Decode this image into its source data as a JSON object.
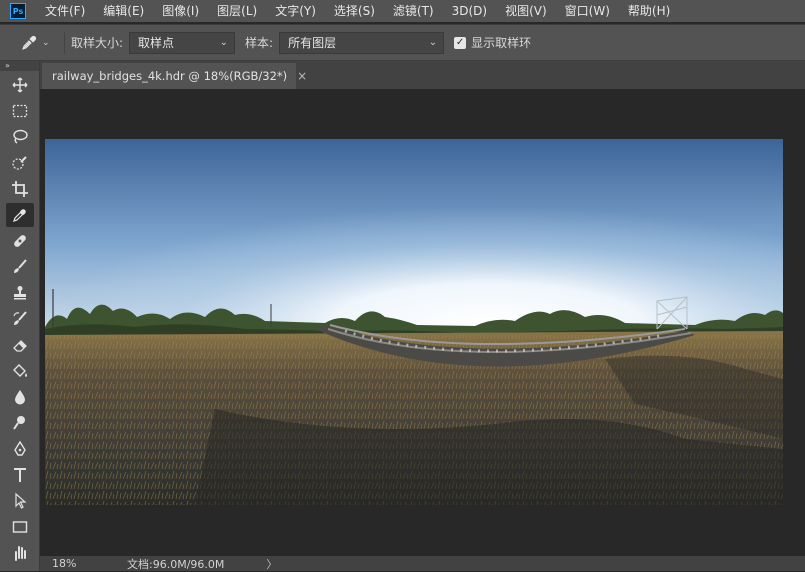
{
  "app": {
    "logo_text": "Ps"
  },
  "menubar": {
    "items": [
      "文件(F)",
      "编辑(E)",
      "图像(I)",
      "图层(L)",
      "文字(Y)",
      "选择(S)",
      "滤镜(T)",
      "3D(D)",
      "视图(V)",
      "窗口(W)",
      "帮助(H)"
    ]
  },
  "options": {
    "sample_size_label": "取样大小:",
    "sample_size_value": "取样点",
    "sample_label": "样本:",
    "sample_value": "所有图层",
    "show_ring_label": "显示取样环",
    "show_ring_checked": true
  },
  "document": {
    "tab_title": "railway_bridges_4k.hdr @ 18%(RGB/32*)",
    "close_glyph": "×"
  },
  "status": {
    "zoom": "18%",
    "doc_info": "文档:96.0M/96.0M",
    "arrow": "〉"
  },
  "tools": [
    "move-tool",
    "marquee-tool",
    "lasso-tool",
    "quick-selection-tool",
    "crop-tool",
    "eyedropper-tool",
    "healing-brush-tool",
    "brush-tool",
    "clone-stamp-tool",
    "history-brush-tool",
    "eraser-tool",
    "paint-bucket-tool",
    "blur-tool",
    "dodge-tool",
    "pen-tool",
    "type-tool",
    "path-selection-tool",
    "rectangle-tool",
    "hand-tool"
  ],
  "active_tool": "eyedropper-tool"
}
